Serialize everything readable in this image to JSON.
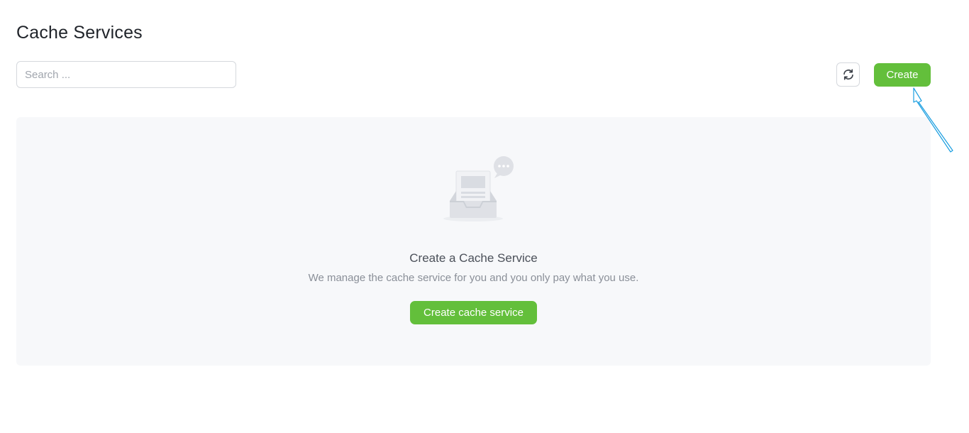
{
  "header": {
    "title": "Cache Services"
  },
  "toolbar": {
    "search_placeholder": "Search ...",
    "search_value": "",
    "refresh_icon": "refresh-icon",
    "create_label": "Create"
  },
  "empty_state": {
    "illustration_icon": "empty-inbox-icon",
    "title": "Create a Cache Service",
    "description": "We manage the cache service for you and you only pay what you use.",
    "cta_label": "Create cache service"
  },
  "colors": {
    "accent_green": "#63bf3b",
    "panel_background": "#f7f8fa",
    "annotation_arrow": "#1a9ee0"
  }
}
